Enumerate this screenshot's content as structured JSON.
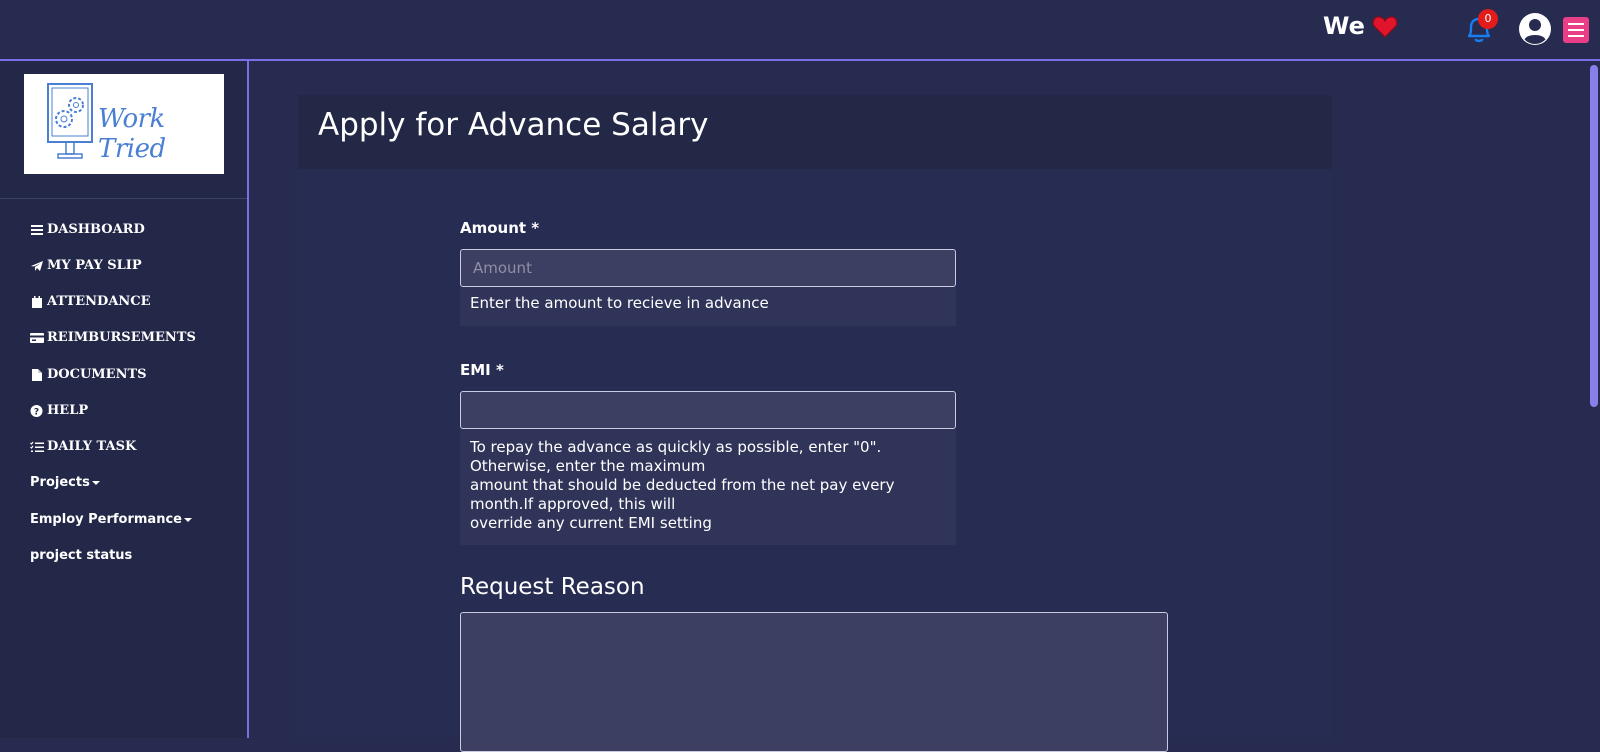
{
  "topbar": {
    "we_text": "We",
    "notification_count": "0"
  },
  "logo": {
    "text": "Work Tried"
  },
  "sidebar": {
    "items": [
      {
        "label": "DASHBOARD",
        "icon": "bars-icon"
      },
      {
        "label": "MY PAY SLIP",
        "icon": "paper-plane-icon"
      },
      {
        "label": "ATTENDANCE",
        "icon": "calendar-icon"
      },
      {
        "label": "REIMBURSEMENTS",
        "icon": "credit-card-icon"
      },
      {
        "label": "DOCUMENTS",
        "icon": "file-icon"
      },
      {
        "label": "HELP",
        "icon": "question-circle-icon"
      },
      {
        "label": "DAILY TASK",
        "icon": "task-list-icon"
      },
      {
        "label": "Projects"
      },
      {
        "label": "Employ Performance"
      },
      {
        "label": "project status"
      }
    ]
  },
  "main": {
    "title": "Apply for Advance Salary",
    "amount": {
      "label": "Amount *",
      "placeholder": "Amount",
      "value": "",
      "help": "Enter the amount to recieve in advance"
    },
    "emi": {
      "label": "EMI *",
      "value": "",
      "help_lines": [
        "To repay the advance as quickly as possible, enter \"0\".",
        "Otherwise, enter the maximum",
        "amount that should be deducted from the net pay every",
        "month.If approved, this will",
        "override any current EMI setting"
      ]
    },
    "reason": {
      "title": "Request Reason",
      "value": ""
    }
  },
  "colors": {
    "background": "#262b4f",
    "sidebar": "#232848",
    "accent_border": "#7b6ee6",
    "menu_button": "#e93f86",
    "badge": "#e41b1b",
    "bell": "#1a7cf0",
    "heart": "#e0142b"
  }
}
